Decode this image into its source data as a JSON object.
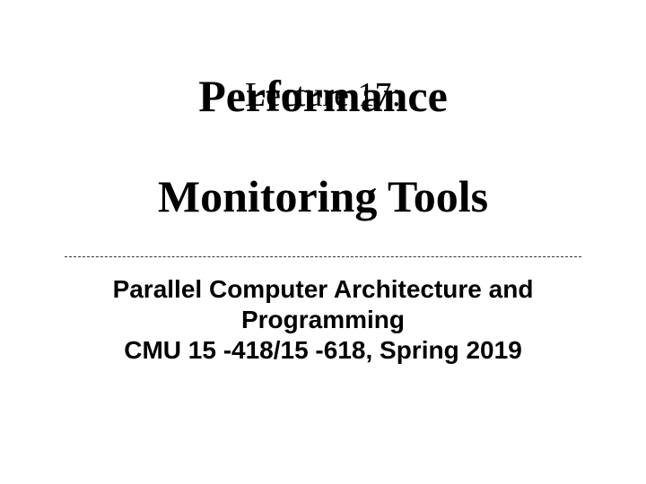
{
  "title": {
    "lecture_label": "Lecture 17:",
    "line1": "Performance",
    "line2": "Monitoring Tools"
  },
  "subtitle": {
    "line1": "Parallel Computer Architecture and",
    "line2": "Programming",
    "line3": "CMU 15 -418/15 -618, Spring 2019"
  }
}
